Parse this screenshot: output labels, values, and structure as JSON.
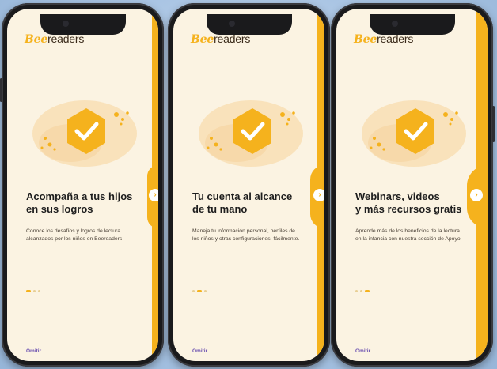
{
  "brand": {
    "logo_prefix": "Bee",
    "logo_suffix": "readers"
  },
  "screens": [
    {
      "title": "Acompaña a tus hijos\nen sus logros",
      "description": "Conoce los desafíos y logros de lectura alcanzados por los niños en Beereaders",
      "skip_label": "Omitir",
      "active_dot": 0
    },
    {
      "title": "Tu cuenta al alcance\nde tu mano",
      "description": "Maneja tu información personal, perfiles de los niños y otras configuraciones, fácilmente.",
      "skip_label": "Omitir",
      "active_dot": 1
    },
    {
      "title": "Webinars, videos\ny más recursos gratis",
      "description": "Aprende más de los beneficios de la lectura en la infancia con nuestra sección de Apoyo.",
      "skip_label": "Omitir",
      "active_dot": 2
    }
  ],
  "colors": {
    "brand_yellow": "#f5b21d",
    "screen_bg": "#fbf3e2",
    "skip_purple": "#6a4fb0"
  },
  "icons": {
    "illustration": "hexagon-checkmark-icon",
    "next": "chevron-right-icon"
  }
}
